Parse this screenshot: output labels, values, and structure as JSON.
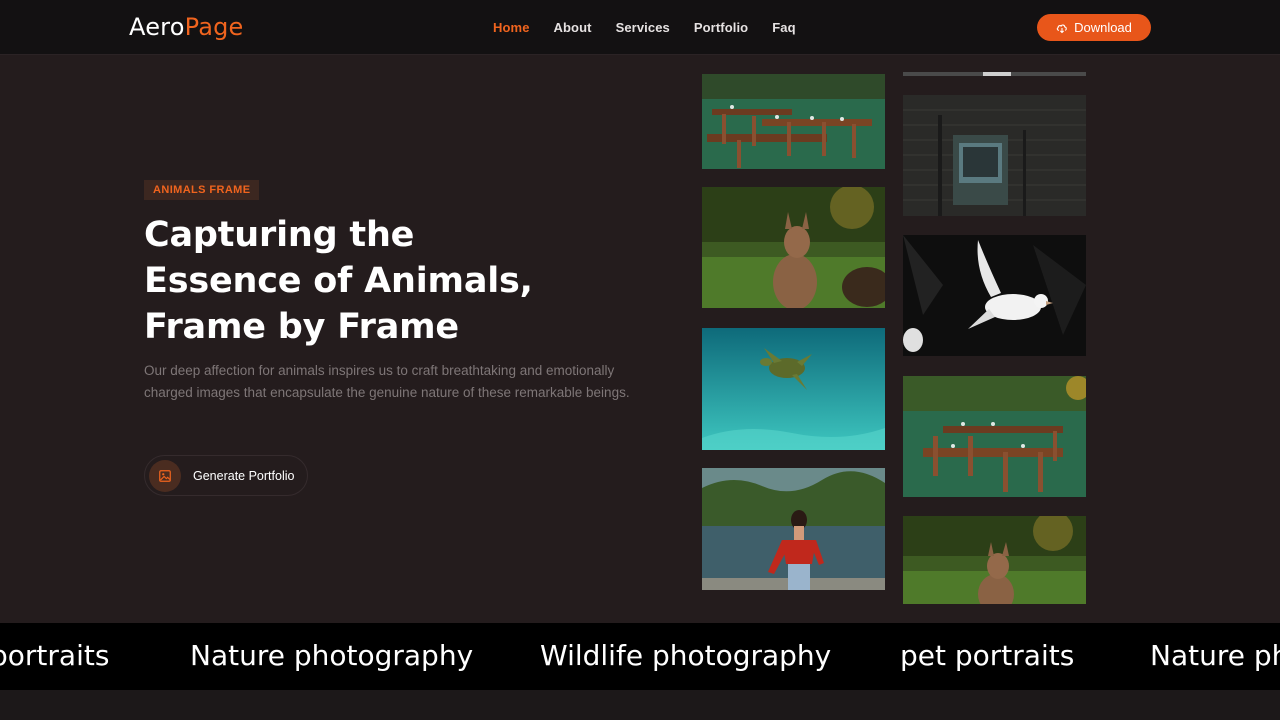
{
  "brand": {
    "part1": "Aero",
    "part2": "Page"
  },
  "nav": {
    "items": [
      "Home",
      "About",
      "Services",
      "Portfolio",
      "Faq"
    ],
    "download_label": "Download"
  },
  "hero": {
    "badge": "ANIMALS FRAME",
    "title": "Capturing the Essence of Animals, Frame by Frame",
    "description": "Our deep affection for animals inspires us to craft breathtaking and emotionally charged images that encapsulate the genuine nature of these remarkable beings.",
    "cta_label": "Generate Portfolio"
  },
  "gallery": {
    "left_column": [
      "outdoor-dining-tables",
      "kangaroo",
      "sea-turtle",
      "woman-by-lake"
    ],
    "right_column": [
      "wall-fragment",
      "old-cabinet",
      "white-dove",
      "outdoor-dining-tables",
      "kangaroo"
    ]
  },
  "marquee": {
    "items": [
      "portraits",
      "Nature photography",
      "Wildlife photography",
      "pet portraits",
      "Nature ph"
    ]
  },
  "colors": {
    "accent": "#f0641e",
    "background": "#241c1d",
    "nav": "#131112"
  }
}
